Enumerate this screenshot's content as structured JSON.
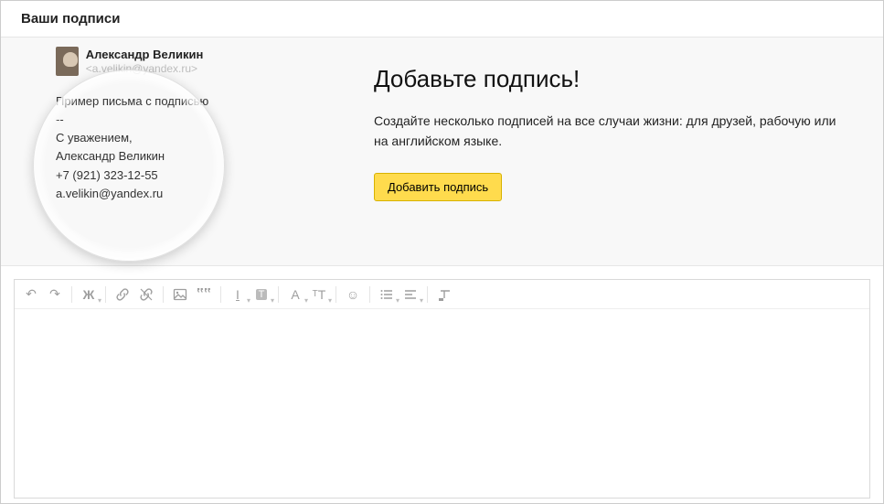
{
  "header": {
    "title": "Ваши подписи"
  },
  "example": {
    "name": "Александр Великин",
    "email": "<a.velikin@yandex.ru>",
    "subject": "Пример письма с подписью",
    "separator": "--",
    "greeting": "С уважением,",
    "fullname": "Александр Великин",
    "phone": "+7 (921) 323-12-55",
    "mail": "a.velikin@yandex.ru"
  },
  "promo": {
    "title": "Добавьте подпись!",
    "description": "Создайте несколько подписей на все случаи жизни: для друзей, рабочую или на английском языке.",
    "button": "Добавить подпись"
  },
  "toolbar": {
    "undo": "Отменить",
    "redo": "Повторить",
    "bold": "Начертание",
    "link": "Вставить ссылку",
    "unlink": "Удалить ссылку",
    "image": "Вставить изображение",
    "quote": "Цитата",
    "textcolor": "Цвет текста",
    "bgcolor": "Цвет фона",
    "font": "Шрифт",
    "size": "Размер шрифта",
    "emoji": "Смайлик",
    "list": "Список",
    "align": "Выравнивание",
    "clear": "Очистить форматирование"
  }
}
